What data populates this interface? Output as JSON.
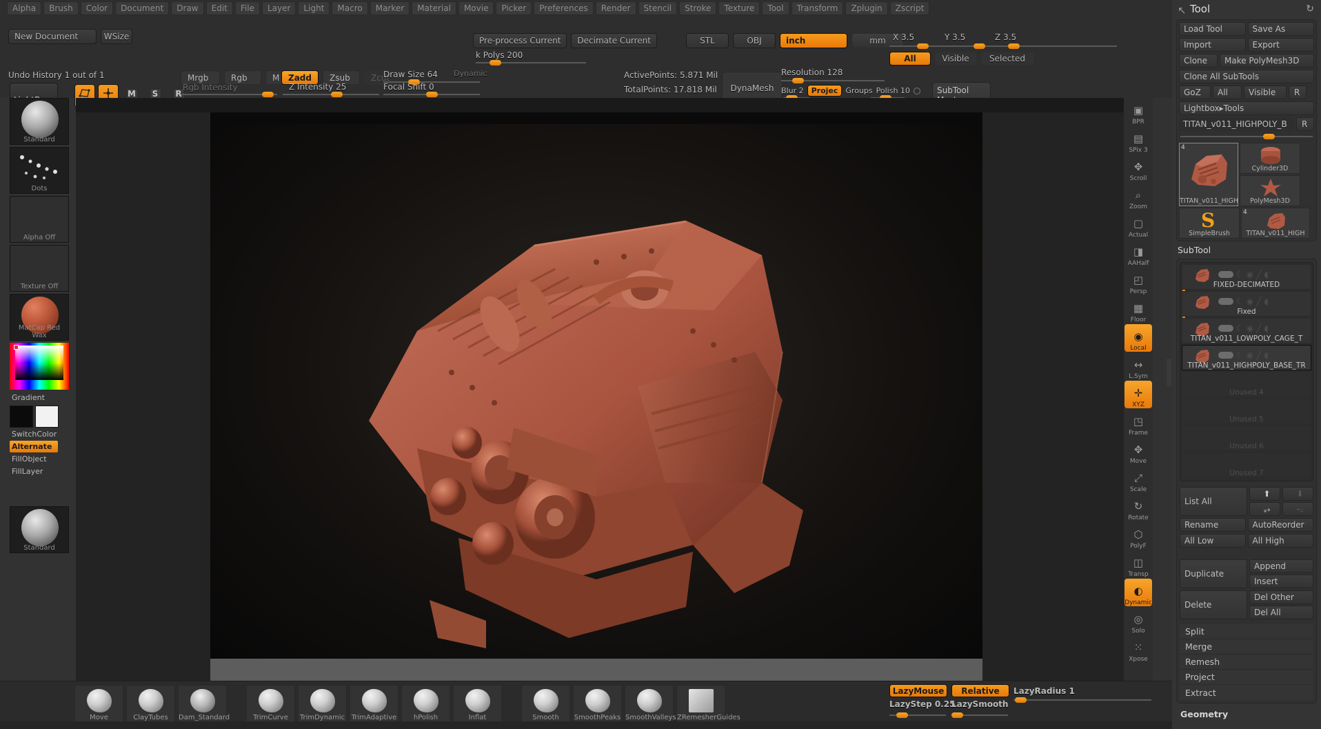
{
  "menubar": {
    "items": [
      "Alpha",
      "Brush",
      "Color",
      "Document",
      "Draw",
      "Edit",
      "File",
      "Layer",
      "Light",
      "Macro",
      "Marker",
      "Material",
      "Movie",
      "Picker",
      "Preferences",
      "Render",
      "Stencil",
      "Stroke",
      "Texture",
      "Tool",
      "Transform",
      "Zplugin",
      "Zscript"
    ]
  },
  "document": {
    "new_document": "New Document",
    "wsize": "WSize",
    "undo_history": "Undo History 1 out of 1",
    "lightbox": "LightBox"
  },
  "decimation": {
    "preprocess": "Pre-process Current",
    "decimate": "Decimate Current",
    "k_polys": "k Polys 200"
  },
  "export": {
    "stl": "STL",
    "obj": "OBJ",
    "inch": "inch",
    "mm": "mm",
    "x_label": "X 3.5",
    "y_label": "Y 3.5",
    "z_label": "Z 3.5",
    "all": "All",
    "visible": "Visible",
    "selected": "Selected"
  },
  "draw_tools": {
    "edit": "Edit",
    "draw": "Draw",
    "move": "Move",
    "scale": "Scale",
    "rotate": "Rotate",
    "mrgb": "Mrgb",
    "rgb": "Rgb",
    "m": "M",
    "zadd": "Zadd",
    "zsub": "Zsub",
    "zcut": "Zcut",
    "rgb_intensity": "Rgb Intensity",
    "z_intensity": "Z Intensity 25",
    "draw_size": "Draw Size 64",
    "dynamic": "Dynamic",
    "focal_shift": "Focal Shift 0"
  },
  "stats": {
    "active_points": "ActivePoints: 5.871 Mil",
    "total_points": "TotalPoints: 17.818 Mil"
  },
  "dynamesh": {
    "title": "DynaMesh",
    "resolution": "Resolution 128",
    "blur": "Blur 2",
    "project": "Projec",
    "groups": "Groups",
    "polish": "Polish 10",
    "subtool_master": "SubTool\nMaster"
  },
  "left_palette": {
    "alpha_standard": "Standard",
    "stroke_dots": "Dots",
    "alpha_off": "Alpha Off",
    "texture_off": "Texture Off",
    "material": "MatCap Red Wax",
    "gradient": "Gradient",
    "switch_color": "SwitchColor",
    "alternate": "Alternate",
    "fill_object": "FillObject",
    "fill_layer": "FillLayer",
    "brush_standard": "Standard"
  },
  "right_strip": {
    "items": [
      {
        "label": "BPR",
        "icon": "bpr-icon",
        "active": false
      },
      {
        "label": "SPix 3",
        "icon": "spix-icon",
        "active": false
      },
      {
        "label": "Scroll",
        "icon": "scroll-icon",
        "active": false
      },
      {
        "label": "Zoom",
        "icon": "zoom-icon",
        "active": false
      },
      {
        "label": "Actual",
        "icon": "actual-icon",
        "active": false
      },
      {
        "label": "AAHalf",
        "icon": "aahalf-icon",
        "active": false
      },
      {
        "label": "Persp",
        "icon": "perspective-icon",
        "active": false
      },
      {
        "label": "Floor",
        "icon": "floor-grid-icon",
        "active": false
      },
      {
        "label": "Local",
        "icon": "local-pivot-icon",
        "active": true
      },
      {
        "label": "L.Sym",
        "icon": "local-symmetry-icon",
        "active": false
      },
      {
        "label": "XYZ",
        "icon": "xyz-axis-icon",
        "active": true
      },
      {
        "label": "Frame",
        "icon": "frame-icon",
        "active": false
      },
      {
        "label": "Move",
        "icon": "move-gizmo-icon",
        "active": false
      },
      {
        "label": "Scale",
        "icon": "scale-gizmo-icon",
        "active": false
      },
      {
        "label": "Rotate",
        "icon": "rotate-gizmo-icon",
        "active": false
      },
      {
        "label": "PolyF",
        "icon": "polyframe-icon",
        "active": false
      },
      {
        "label": "Transp",
        "icon": "transparency-icon",
        "active": false
      },
      {
        "label": "Dynamic",
        "icon": "dynamic-persp-icon",
        "active": true
      },
      {
        "label": "Solo",
        "icon": "solo-icon",
        "active": false
      },
      {
        "label": "Xpose",
        "icon": "xpose-icon",
        "active": false
      }
    ]
  },
  "tool_panel": {
    "title": "Tool",
    "reset_icon": "refresh-icon",
    "buttons": {
      "load_tool": "Load Tool",
      "save_as": "Save As",
      "import": "Import",
      "export": "Export",
      "clone": "Clone",
      "make_polymesh3d": "Make PolyMesh3D",
      "clone_all_subtools": "Clone All SubTools",
      "goz": "GoZ",
      "all": "All",
      "visible": "Visible",
      "r": "R",
      "lightbox_tools": "Lightbox▸Tools",
      "current_tool": "TITAN_v011_HIGHPOLY_B"
    },
    "thumbs": [
      {
        "name": "TITAN_v011_HIGH",
        "badge": "4",
        "kind": "engine",
        "selected": true
      },
      {
        "name": "Cylinder3D",
        "badge": "",
        "kind": "cylinder",
        "selected": false
      },
      {
        "name": "PolyMesh3D",
        "badge": "",
        "kind": "star",
        "selected": false
      },
      {
        "name": "SimpleBrush",
        "badge": "",
        "kind": "s-logo",
        "selected": false
      },
      {
        "name": "TITAN_v011_HIGH",
        "badge": "4",
        "kind": "engine",
        "selected": false
      }
    ]
  },
  "subtool": {
    "header": "SubTool",
    "rows": [
      {
        "name": "FIXED-DECIMATED",
        "empty": false,
        "selected": false
      },
      {
        "name": "Fixed",
        "empty": false,
        "selected": false
      },
      {
        "name": "TITAN_v011_LOWPOLY_CAGE_T",
        "empty": false,
        "selected": false
      },
      {
        "name": "TITAN_v011_HIGHPOLY_BASE_TR",
        "empty": false,
        "selected": true
      },
      {
        "name": "Unused 4",
        "empty": true,
        "selected": false
      },
      {
        "name": "Unused 5",
        "empty": true,
        "selected": false
      },
      {
        "name": "Unused 6",
        "empty": true,
        "selected": false
      },
      {
        "name": "Unused 7",
        "empty": true,
        "selected": false
      }
    ],
    "controls": {
      "list_all": "List All",
      "up_icon": "arrow-up-icon",
      "down_icon": "arrow-down-icon",
      "out_icon": "arrow-out-icon",
      "in_icon": "arrow-in-icon",
      "rename": "Rename",
      "autoreorder": "AutoReorder",
      "all_low": "All Low",
      "all_high": "All High",
      "duplicate": "Duplicate",
      "append": "Append",
      "insert": "Insert",
      "delete": "Delete",
      "del_other": "Del Other",
      "del_all": "Del All",
      "split": "Split",
      "merge": "Merge",
      "remesh": "Remesh",
      "project": "Project",
      "extract": "Extract",
      "geometry": "Geometry"
    }
  },
  "bottom_bar": {
    "brushes": [
      {
        "label": "Move",
        "icon": "move-brush-icon"
      },
      {
        "label": "ClayTubes",
        "icon": "claytubes-brush-icon"
      },
      {
        "label": "Dam_Standard",
        "icon": "dam-standard-brush-icon"
      },
      {
        "label": "TrimCurve",
        "icon": "trimcurve-brush-icon"
      },
      {
        "label": "TrimDynamic",
        "icon": "trimdynamic-brush-icon"
      },
      {
        "label": "TrimAdaptive",
        "icon": "trimadaptive-brush-icon"
      },
      {
        "label": "hPolish",
        "icon": "hpolish-brush-icon"
      },
      {
        "label": "Inflat",
        "icon": "inflat-brush-icon"
      },
      {
        "label": "Smooth",
        "icon": "smooth-brush-icon"
      },
      {
        "label": "SmoothPeaks",
        "icon": "smoothpeaks-brush-icon"
      },
      {
        "label": "SmoothValleys",
        "icon": "smoothvalleys-brush-icon"
      },
      {
        "label": "ZRemesherGuides",
        "icon": "zremesherguides-brush-icon"
      }
    ],
    "lazy": {
      "lazy_mouse": "LazyMouse",
      "relative": "Relative",
      "lazy_radius": "LazyRadius 1",
      "lazy_step": "LazyStep 0.25",
      "lazy_smooth": "LazySmooth"
    }
  },
  "colors": {
    "accent": "#ef8c10",
    "panel": "#343434",
    "toolbar": "#2e2e2e",
    "clay_red": "#b05a44"
  }
}
